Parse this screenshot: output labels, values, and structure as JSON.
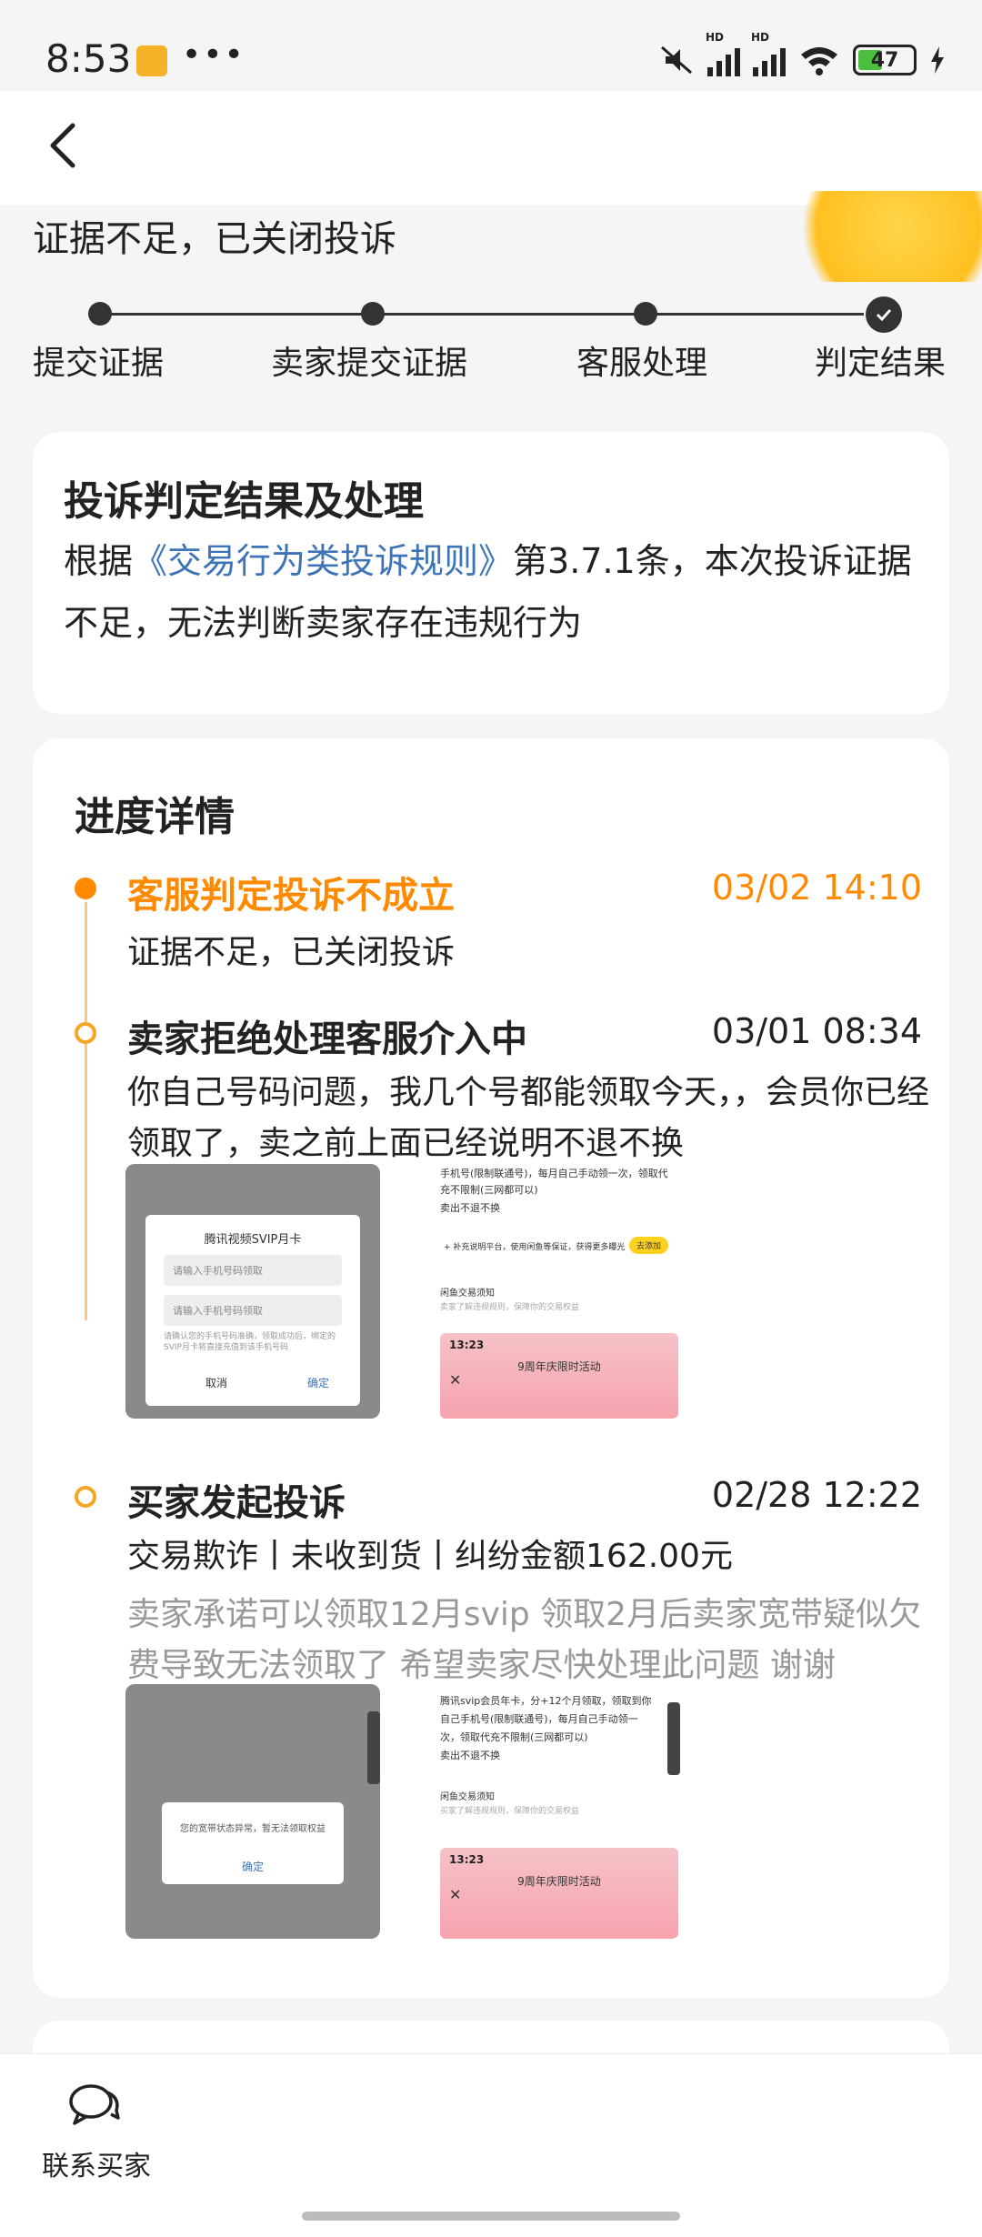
{
  "status_bar": {
    "time": "8:53",
    "dots": "•••",
    "hd1": "HD",
    "hd2": "HD",
    "battery": "47"
  },
  "header": {
    "back_icon": "back-arrow-icon"
  },
  "complaint": {
    "status": "证据不足，已关闭投诉",
    "steps": [
      "提交证据",
      "卖家提交证据",
      "客服处理",
      "判定结果"
    ]
  },
  "result": {
    "title": "投诉判定结果及处理",
    "prefix": "根据",
    "rule_link": "《交易行为类投诉规则》",
    "suffix": "第3.7.1条，本次投诉证据不足，无法判断卖家存在违规行为"
  },
  "progress": {
    "title": "进度详情",
    "events": [
      {
        "title": "客服判定投诉不成立",
        "time": "03/02 14:10",
        "text": "证据不足，已关闭投诉"
      },
      {
        "title": "卖家拒绝处理客服介入中",
        "time": "03/01 08:34",
        "text": "你自己号码问题，我几个号都能领取今天，，会员你已经领取了，卖之前上面已经说明不退不换"
      },
      {
        "title": "买家发起投诉",
        "time": "02/28 12:22",
        "text": "交易欺诈丨未收到货丨纠纷金额162.00元",
        "note": "卖家承诺可以领取12月svip 领取2月后卖家宽带疑似欠费导致无法领取了 希望卖家尽快处理此问题 谢谢"
      }
    ]
  },
  "thumbs": {
    "dialog1_title": "腾讯视频SVIP月卡",
    "dialog1_input1": "请输入手机号码领取",
    "dialog1_input2": "请输入手机号码领取",
    "dialog1_note": "请确认您的手机号码准确，领取成功后，绑定的SVIP月卡将直接充值到该手机号码",
    "dialog1_cancel": "取消",
    "dialog1_ok": "确定",
    "page1_line1": "手机号(限制联通号)，每月自己手动领一次，领取代",
    "page1_line2": "充不限制(三网都可以)",
    "page1_line3": "卖出不退不换",
    "page1_tip": "+ 补充说明平台，使用闲鱼等保证，获得更多曝光",
    "page1_tag": "去添加",
    "page1_section": "闲鱼交易须知",
    "page1_section_sub": "卖家了解违规规则，保障你的交易权益",
    "banner_time": "13:23",
    "banner_text": "9周年庆限时活动",
    "dialog2_text": "您的宽带状态异常，暂无法领取权益",
    "dialog2_ok": "确定",
    "page2_line1": "腾讯svip会员年卡，分+12个月领取，领取到你",
    "page2_line2": "自己手机号(限制联通号)，每月自己手动领一",
    "page2_line3": "次，领取代充不限制(三网都可以)",
    "page2_line4": "卖出不退不换",
    "page2_section": "闲鱼交易须知",
    "page2_section_sub": "买家了解违规规则，保障你的交易权益"
  },
  "bottom": {
    "contact_label": "联系买家"
  }
}
